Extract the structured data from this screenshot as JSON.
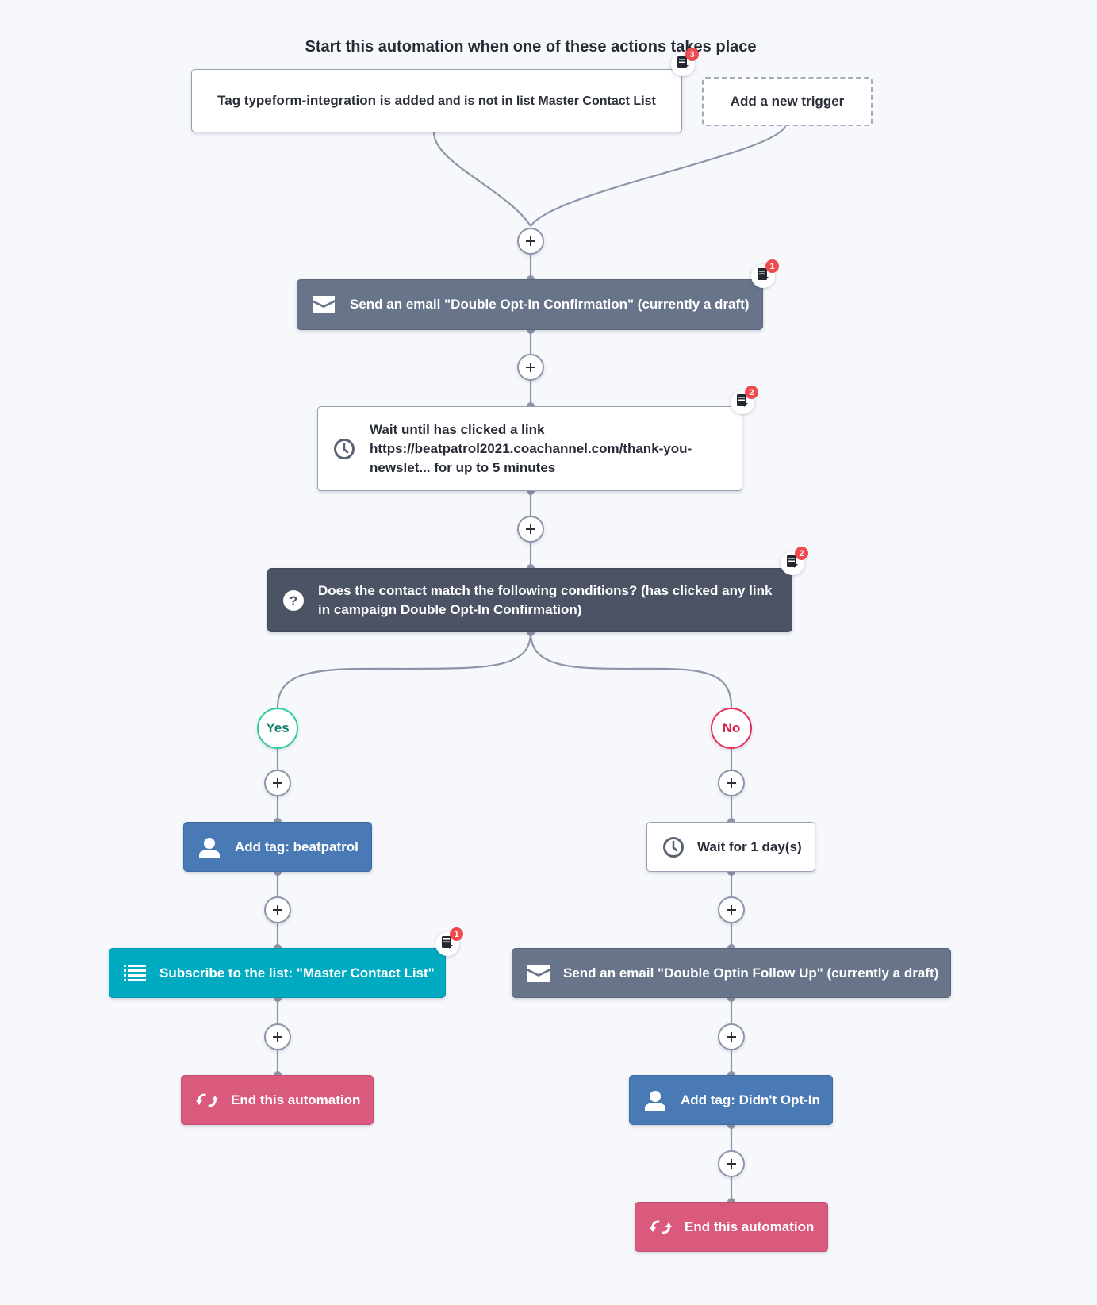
{
  "header": {
    "title": "Start this automation when one of these actions takes place"
  },
  "triggers": [
    {
      "bold": "Tag typeform-integration is added",
      "rest": " and is not in list Master Contact List",
      "notes_count": "3"
    }
  ],
  "add_trigger": {
    "label": "Add a new trigger"
  },
  "colors": {
    "background": "#f6f8fc",
    "email": "#677489",
    "condition": "#4c5365",
    "tag": "#4a7ab5",
    "subscribe": "#00abc2",
    "end": "#da5a7d",
    "yes": "#2ecc9a",
    "no": "#e8305a",
    "badge": "#ef4a50",
    "wire": "#8e95aa"
  },
  "steps": {
    "send_email_1": {
      "icon": "envelope-icon",
      "label": "Send an email \"Double Opt-In Confirmation\" (currently a draft)",
      "notes_count": "1"
    },
    "wait_link": {
      "icon": "clock-icon",
      "line1": "Wait until has clicked a link",
      "line2": "https://beatpatrol2021.coachannel.com/thank-you-",
      "line3": "newslet... for up to 5 minutes",
      "notes_count": "2"
    },
    "condition": {
      "icon": "question-icon",
      "line1": "Does the contact match the following conditions? (has clicked any link",
      "line2": "in campaign Double Opt-In Confirmation)",
      "notes_count": "2"
    }
  },
  "branches": {
    "yes": {
      "label": "Yes",
      "steps": [
        {
          "type": "tag",
          "icon": "user-icon",
          "label": "Add tag: beatpatrol"
        },
        {
          "type": "subscribe",
          "icon": "list-icon",
          "label": "Subscribe to the list: \"Master Contact List\"",
          "notes_count": "1"
        },
        {
          "type": "end",
          "icon": "loop-icon",
          "label": "End this automation"
        }
      ]
    },
    "no": {
      "label": "No",
      "steps": [
        {
          "type": "wait",
          "icon": "clock-icon",
          "label": "Wait for 1 day(s)"
        },
        {
          "type": "email",
          "icon": "envelope-icon",
          "label": "Send an email \"Double Optin Follow Up\" (currently a draft)"
        },
        {
          "type": "tag",
          "icon": "user-icon",
          "label": "Add tag: Didn't Opt-In"
        },
        {
          "type": "end",
          "icon": "loop-icon",
          "label": "End this automation"
        }
      ]
    }
  },
  "add_step_symbol": "+"
}
